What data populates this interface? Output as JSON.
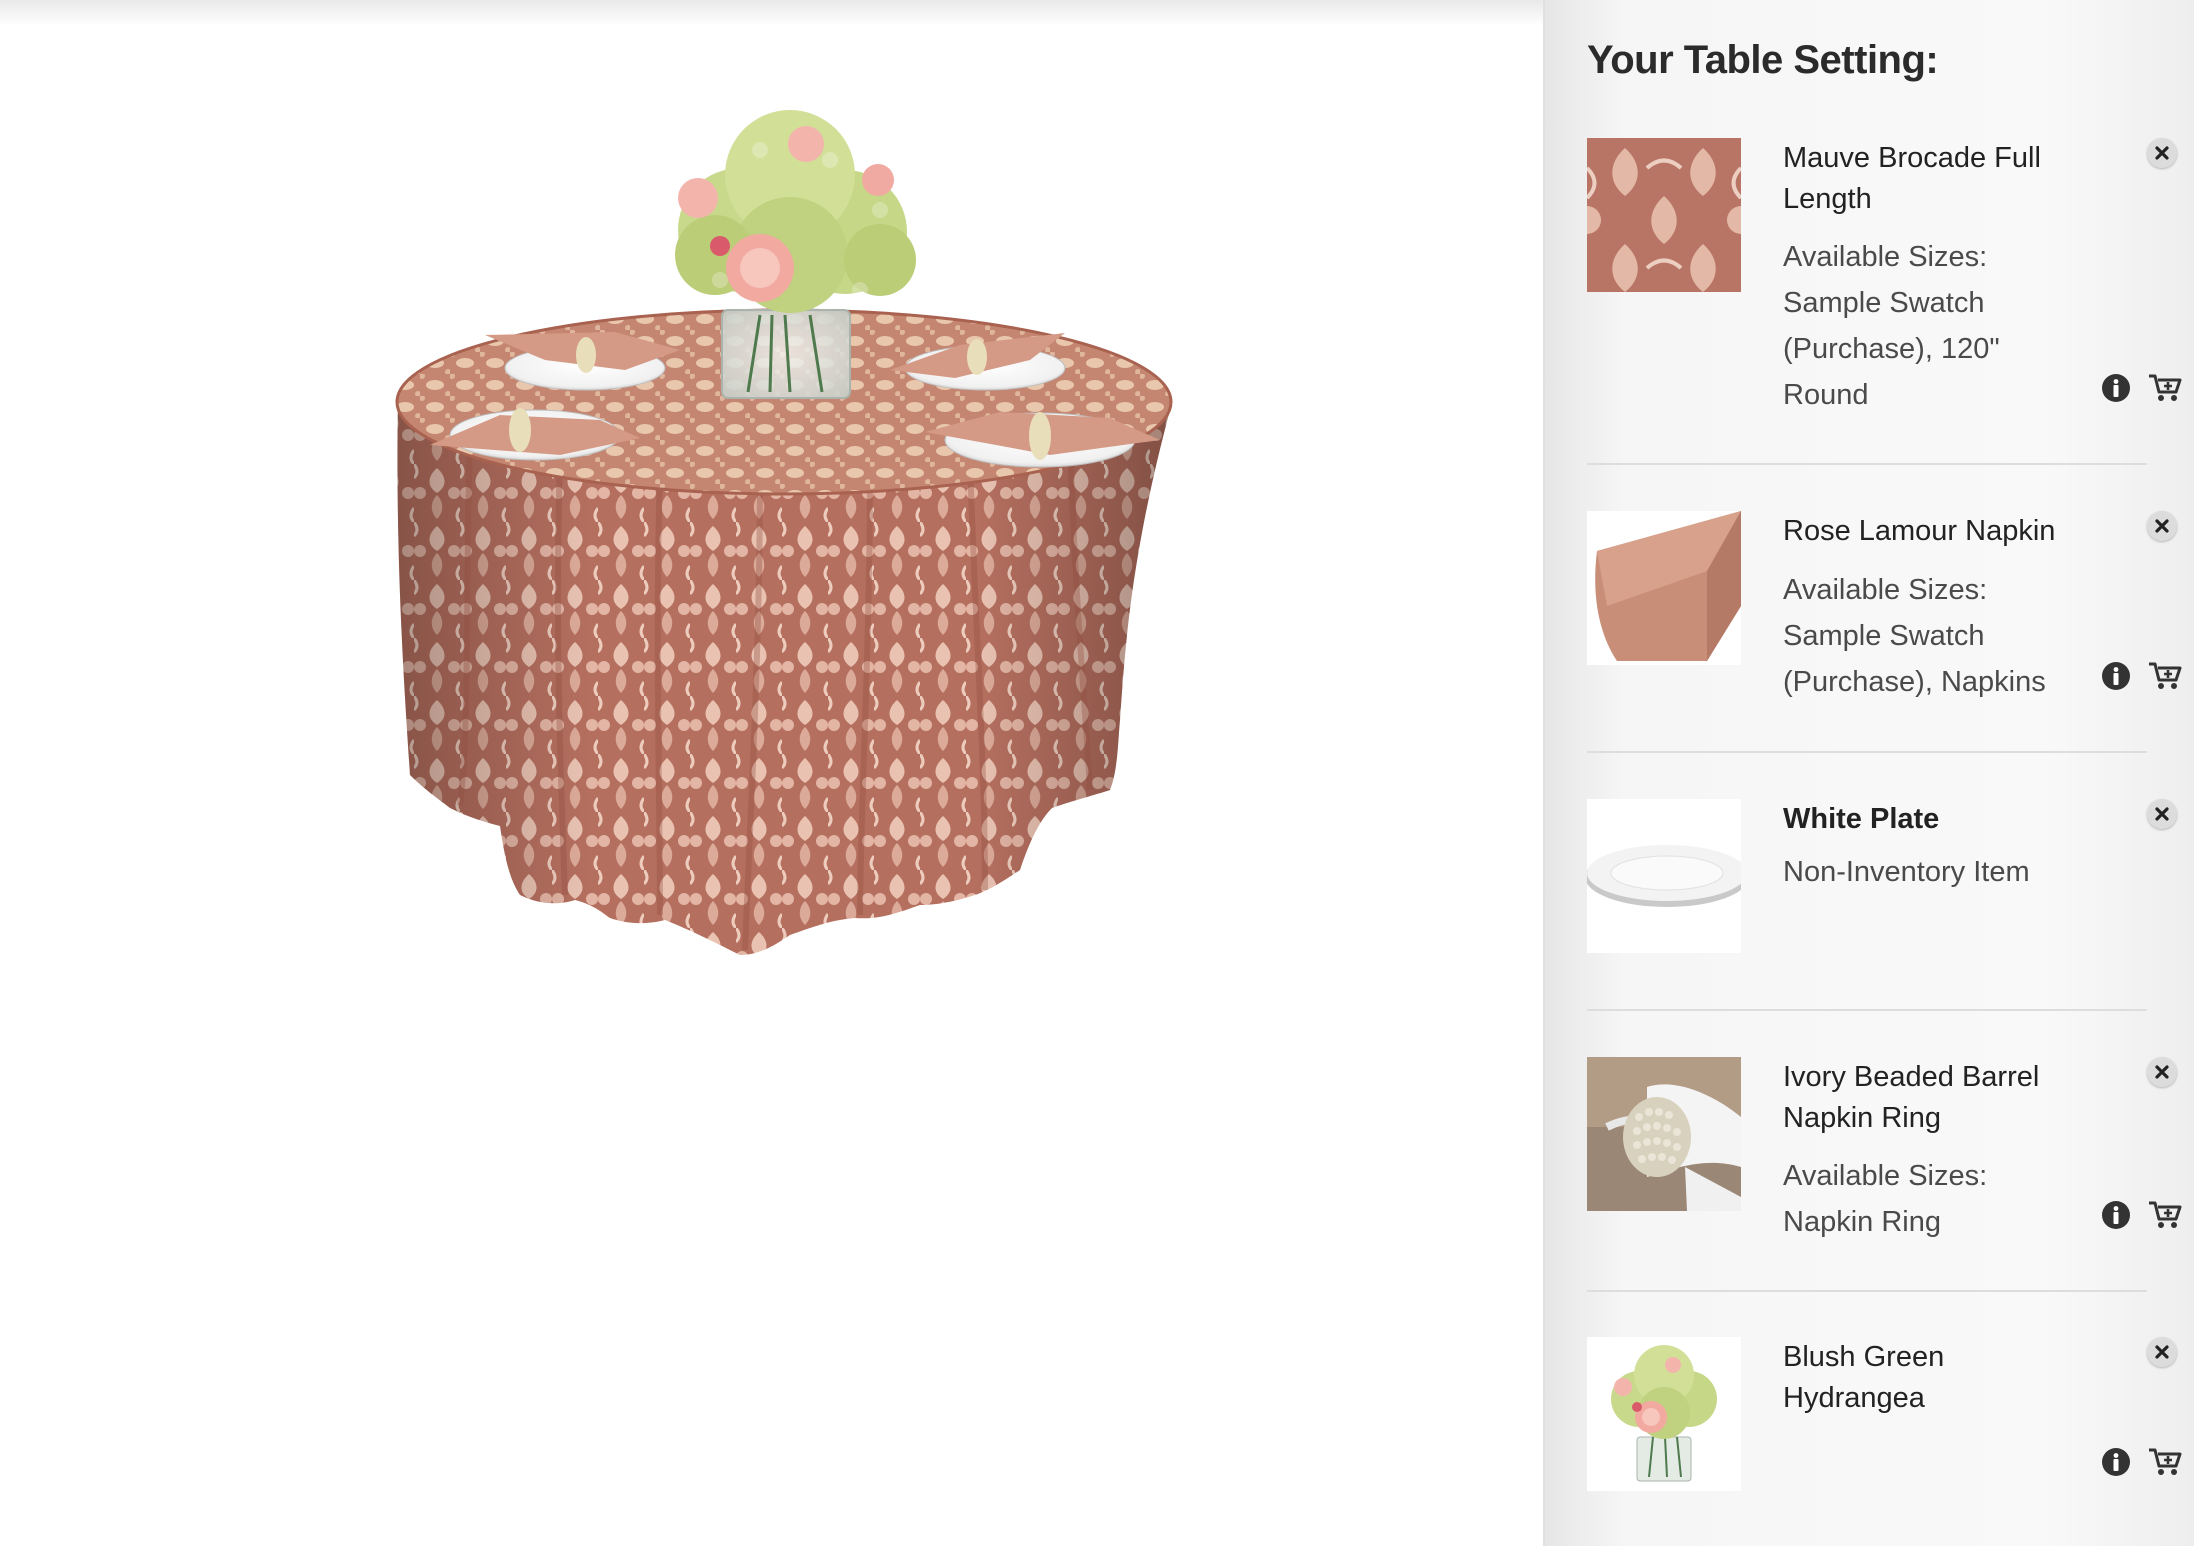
{
  "sidebar": {
    "title": "Your Table Setting:",
    "items": [
      {
        "name": "Mauve Brocade Full Length",
        "sizes_label": "Available Sizes:",
        "sizes_value": "Sample Swatch (Purchase), 120\" Round",
        "thumb": "mauve-brocade-swatch"
      },
      {
        "name": "Rose Lamour Napkin",
        "sizes_label": "Available Sizes:",
        "sizes_value": "Sample Swatch (Purchase), Napkins",
        "thumb": "rose-napkin"
      },
      {
        "name": "White Plate",
        "note": "Non-Inventory Item",
        "thumb": "white-plate"
      },
      {
        "name": "Ivory Beaded Barrel Napkin Ring",
        "sizes_label": "Available Sizes:",
        "sizes_value": "Napkin Ring",
        "thumb": "napkin-ring"
      },
      {
        "name": "Blush Green Hydrangea",
        "thumb": "hydrangea-centerpiece"
      }
    ]
  },
  "colors": {
    "tablecloth": "#c58b7a",
    "tablecloth_pattern": "#e9c4b4",
    "napkin": "#d49a86",
    "hydrangea": "#c9d98c",
    "rose": "#f1a9a0",
    "sidebar_bg": "#f6f6f6"
  }
}
